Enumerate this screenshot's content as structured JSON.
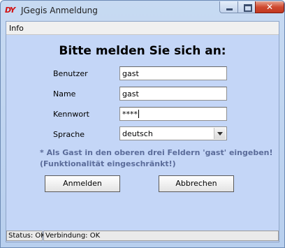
{
  "window": {
    "title": "JGegis Anmeldung",
    "icon_text": "DY",
    "controls": {
      "minimize_icon": "minimize-icon",
      "maximize_icon": "maximize-icon",
      "close_glyph": "✕"
    }
  },
  "menu": {
    "items": [
      "Info"
    ]
  },
  "form": {
    "heading": "Bitte melden Sie sich an:",
    "fields": {
      "user": {
        "label": "Benutzer",
        "value": "gast"
      },
      "name": {
        "label": "Name",
        "value": "gast"
      },
      "password": {
        "label": "Kennwort",
        "value": "****"
      },
      "language": {
        "label": "Sprache",
        "value": "deutsch"
      }
    },
    "hint_line1": "* Als Gast in den oberen drei Feldern 'gast' eingeben!",
    "hint_line2": "(Funktionalität eingeschränkt!)",
    "buttons": {
      "login": "Anmelden",
      "cancel": "Abbrechen"
    }
  },
  "status": {
    "status_text": "Status: OK",
    "connection_text": "Verbindung: OK"
  },
  "colors": {
    "client_bg": "#c4d6f7",
    "hint": "#5b6c9a",
    "close_button": "#cf4a31",
    "app_icon": "#d21010"
  }
}
